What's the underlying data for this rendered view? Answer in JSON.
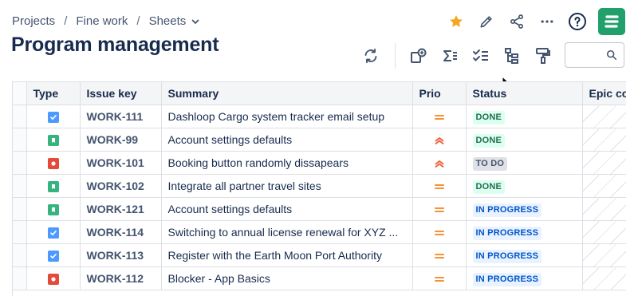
{
  "breadcrumb": [
    "Projects",
    "Fine work",
    "Sheets"
  ],
  "page_title": "Program management",
  "icons": {
    "star": "star-icon",
    "edit": "pencil-icon",
    "share": "share-icon",
    "more": "more-icon",
    "help": "help-icon",
    "logo": "app-logo-icon"
  },
  "colors": {
    "star": "#f5a623",
    "logo": "#22a06b",
    "task": "#4c9aff",
    "story": "#36b37e",
    "bug": "#e5493a",
    "prio_medium": "#f79232",
    "prio_high": "#f15c36"
  },
  "table": {
    "columns": [
      "Type",
      "Issue key",
      "Summary",
      "Prio",
      "Status",
      "Epic co"
    ],
    "rows": [
      {
        "type": "task",
        "key": "WORK-111",
        "summary": "Dashloop Cargo system tracker email setup",
        "prio": "medium",
        "status": "DONE",
        "status_kind": "done"
      },
      {
        "type": "story",
        "key": "WORK-99",
        "summary": "Account settings defaults",
        "prio": "high",
        "status": "DONE",
        "status_kind": "done"
      },
      {
        "type": "bug",
        "key": "WORK-101",
        "summary": "Booking button randomly dissapears",
        "prio": "high",
        "status": "TO DO",
        "status_kind": "todo"
      },
      {
        "type": "story",
        "key": "WORK-102",
        "summary": "Integrate all partner travel sites",
        "prio": "medium",
        "status": "DONE",
        "status_kind": "done"
      },
      {
        "type": "story",
        "key": "WORK-121",
        "summary": "Account settings defaults",
        "prio": "medium",
        "status": "IN PROGRESS",
        "status_kind": "inprogress"
      },
      {
        "type": "task",
        "key": "WORK-114",
        "summary": "Switching to annual license renewal for XYZ ...",
        "prio": "medium",
        "status": "IN PROGRESS",
        "status_kind": "inprogress"
      },
      {
        "type": "task",
        "key": "WORK-113",
        "summary": "Register with the Earth Moon Port Authority",
        "prio": "medium",
        "status": "IN PROGRESS",
        "status_kind": "inprogress"
      },
      {
        "type": "bug",
        "key": "WORK-112",
        "summary": "Blocker - App Basics",
        "prio": "medium",
        "status": "IN PROGRESS",
        "status_kind": "inprogress"
      }
    ]
  }
}
